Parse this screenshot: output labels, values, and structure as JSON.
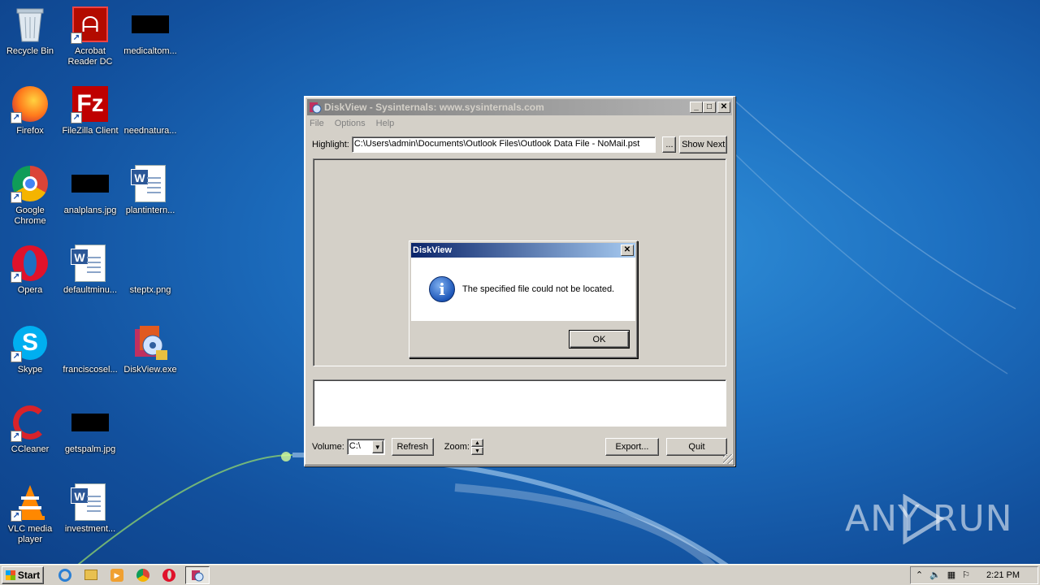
{
  "desktop": {
    "icons": [
      {
        "label": "Recycle Bin",
        "icon": "recycle-bin-icon"
      },
      {
        "label": "Acrobat Reader DC",
        "icon": "acrobat-icon"
      },
      {
        "label": "medicaltom...",
        "icon": "image-file-icon"
      },
      {
        "label": "Firefox",
        "icon": "firefox-icon"
      },
      {
        "label": "FileZilla Client",
        "icon": "filezilla-icon"
      },
      {
        "label": "neednatura...",
        "icon": "image-file-icon"
      },
      {
        "label": "Google Chrome",
        "icon": "chrome-icon"
      },
      {
        "label": "analplans.jpg",
        "icon": "image-file-icon"
      },
      {
        "label": "plantintern...",
        "icon": "word-doc-icon"
      },
      {
        "label": "Opera",
        "icon": "opera-icon"
      },
      {
        "label": "defaultminu...",
        "icon": "word-doc-icon"
      },
      {
        "label": "steptx.png",
        "icon": "image-file-icon"
      },
      {
        "label": "Skype",
        "icon": "skype-icon"
      },
      {
        "label": "franciscosel...",
        "icon": "image-file-icon"
      },
      {
        "label": "DiskView.exe",
        "icon": "diskview-icon"
      },
      {
        "label": "CCleaner",
        "icon": "ccleaner-icon"
      },
      {
        "label": "getspalm.jpg",
        "icon": "image-file-icon"
      },
      {
        "label": "VLC media player",
        "icon": "vlc-icon"
      },
      {
        "label": "investment...",
        "icon": "word-doc-icon"
      }
    ]
  },
  "window": {
    "title": "DiskView - Sysinternals: www.sysinternals.com",
    "menu": [
      "File",
      "Options",
      "Help"
    ],
    "highlight_label": "Highlight:",
    "highlight_value": "C:\\Users\\admin\\Documents\\Outlook Files\\Outlook Data File - NoMail.pst",
    "browse_label": "...",
    "show_next_label": "Show Next",
    "volume_label": "Volume:",
    "volume_value": "C:\\",
    "refresh_label": "Refresh",
    "zoom_label": "Zoom:",
    "export_label": "Export...",
    "quit_label": "Quit"
  },
  "dialog": {
    "title": "DiskView",
    "message": "The specified file could not be located.",
    "ok_label": "OK",
    "close_label": "✕"
  },
  "taskbar": {
    "start_label": "Start",
    "clock": "2:21 PM"
  },
  "watermark": "ANY  RUN"
}
